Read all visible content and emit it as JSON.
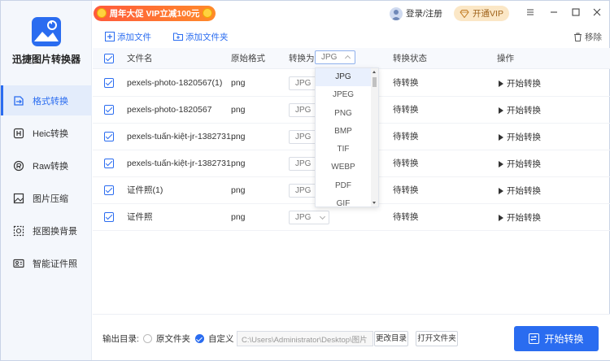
{
  "app": {
    "name": "迅捷图片转换器"
  },
  "promo": {
    "text": "周年大促 VIP立减100元"
  },
  "user": {
    "login_label": "登录/注册"
  },
  "vip": {
    "label": "开通VIP"
  },
  "sidebar": {
    "items": [
      {
        "label": "格式转换",
        "icon": "format-convert-icon",
        "active": true
      },
      {
        "label": "Heic转换",
        "icon": "heic-icon",
        "active": false
      },
      {
        "label": "Raw转换",
        "icon": "raw-icon",
        "active": false
      },
      {
        "label": "图片压缩",
        "icon": "image-compress-icon",
        "active": false
      },
      {
        "label": "抠图换背景",
        "icon": "cutout-icon",
        "active": false
      },
      {
        "label": "智能证件照",
        "icon": "id-photo-icon",
        "active": false
      }
    ]
  },
  "toolbar": {
    "add_file": "添加文件",
    "add_folder": "添加文件夹",
    "remove": "移除"
  },
  "table": {
    "headers": {
      "filename": "文件名",
      "orig_format": "原始格式",
      "convert_to": "转换为",
      "status": "转换状态",
      "action": "操作"
    },
    "header_select_value": "JPG",
    "rows": [
      {
        "filename": "pexels-photo-1820567(1)",
        "format": "png",
        "target": "JPG",
        "status": "待转换",
        "action": "开始转换"
      },
      {
        "filename": "pexels-photo-1820567",
        "format": "png",
        "target": "JPG",
        "status": "待转换",
        "action": "开始转换"
      },
      {
        "filename": "pexels-tuấn-kiệt-jr-1382731...",
        "format": "png",
        "target": "JPG",
        "status": "待转换",
        "action": "开始转换"
      },
      {
        "filename": "pexels-tuấn-kiệt-jr-1382731",
        "format": "png",
        "target": "JPG",
        "status": "待转换",
        "action": "开始转换"
      },
      {
        "filename": "证件照(1)",
        "format": "png",
        "target": "JPG",
        "status": "待转换",
        "action": "开始转换"
      },
      {
        "filename": "证件照",
        "format": "png",
        "target": "JPG",
        "status": "待转换",
        "action": "开始转换"
      }
    ]
  },
  "dropdown": {
    "options": [
      "JPG",
      "JPEG",
      "PNG",
      "BMP",
      "TIF",
      "WEBP",
      "PDF",
      "GIF"
    ],
    "selected": "JPG"
  },
  "bottom": {
    "output_label": "输出目录:",
    "opt_original": "原文件夹",
    "opt_custom": "自定义",
    "path": "C:\\Users\\Administrator\\Desktop\\图片",
    "change_dir": "更改目录",
    "open_folder": "打开文件夹",
    "start_all": "开始转换"
  },
  "colors": {
    "accent": "#2a6cf0",
    "promo": "#ff6a34",
    "vip_bg": "#fbe7c6"
  }
}
